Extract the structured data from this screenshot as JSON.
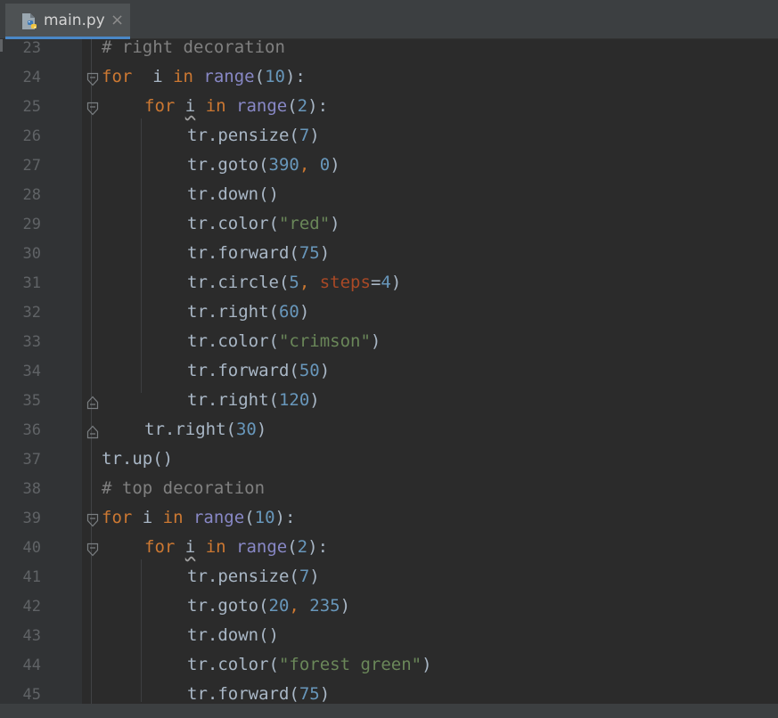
{
  "tab": {
    "filename": "main.py",
    "icon": "python-file-icon",
    "close": "×"
  },
  "colors": {
    "background": "#2b2b2b",
    "gutter": "#313335",
    "keyword": "#cc7832",
    "builtin": "#8888c6",
    "number": "#6897bb",
    "string": "#6a8759",
    "comment": "#808080",
    "kwarg": "#aa4926",
    "text": "#a9b7c6",
    "tab_accent": "#4a88c7"
  },
  "lines": [
    {
      "n": "23",
      "indent": 0,
      "fold": "",
      "tokens": [
        [
          "cm",
          "# right decoration"
        ]
      ]
    },
    {
      "n": "24",
      "indent": 0,
      "fold": "start",
      "tokens": [
        [
          "kw",
          "for"
        ],
        [
          "",
          "  i "
        ],
        [
          "kw",
          "in"
        ],
        [
          "bi",
          " range"
        ],
        [
          "",
          "("
        ],
        [
          "num",
          "10"
        ],
        [
          "",
          "):"
        ]
      ]
    },
    {
      "n": "25",
      "indent": 1,
      "fold": "start",
      "tokens": [
        [
          "kw",
          "for"
        ],
        [
          "",
          " "
        ],
        [
          "sq",
          "i"
        ],
        [
          "",
          " "
        ],
        [
          "kw",
          "in"
        ],
        [
          "bi",
          " range"
        ],
        [
          "",
          "("
        ],
        [
          "num",
          "2"
        ],
        [
          "",
          "):"
        ]
      ]
    },
    {
      "n": "26",
      "indent": 2,
      "fold": "",
      "tokens": [
        [
          "",
          "tr.pensize("
        ],
        [
          "num",
          "7"
        ],
        [
          "",
          ")"
        ]
      ]
    },
    {
      "n": "27",
      "indent": 2,
      "fold": "",
      "tokens": [
        [
          "",
          "tr.goto("
        ],
        [
          "num",
          "390"
        ],
        [
          "kw",
          ", "
        ],
        [
          "num",
          "0"
        ],
        [
          "",
          ")"
        ]
      ]
    },
    {
      "n": "28",
      "indent": 2,
      "fold": "",
      "tokens": [
        [
          "",
          "tr.down()"
        ]
      ]
    },
    {
      "n": "29",
      "indent": 2,
      "fold": "",
      "tokens": [
        [
          "",
          "tr.color("
        ],
        [
          "str",
          "\"red\""
        ],
        [
          "",
          ")"
        ]
      ]
    },
    {
      "n": "30",
      "indent": 2,
      "fold": "",
      "tokens": [
        [
          "",
          "tr.forward("
        ],
        [
          "num",
          "75"
        ],
        [
          "",
          ")"
        ]
      ]
    },
    {
      "n": "31",
      "indent": 2,
      "fold": "",
      "tokens": [
        [
          "",
          "tr.circle("
        ],
        [
          "num",
          "5"
        ],
        [
          "kw",
          ", "
        ],
        [
          "kwarg",
          "steps"
        ],
        [
          "",
          "="
        ],
        [
          "num",
          "4"
        ],
        [
          "",
          ")"
        ]
      ]
    },
    {
      "n": "32",
      "indent": 2,
      "fold": "",
      "tokens": [
        [
          "",
          "tr.right("
        ],
        [
          "num",
          "60"
        ],
        [
          "",
          ")"
        ]
      ]
    },
    {
      "n": "33",
      "indent": 2,
      "fold": "",
      "tokens": [
        [
          "",
          "tr.color("
        ],
        [
          "str",
          "\"crimson\""
        ],
        [
          "",
          ")"
        ]
      ]
    },
    {
      "n": "34",
      "indent": 2,
      "fold": "",
      "tokens": [
        [
          "",
          "tr.forward("
        ],
        [
          "num",
          "50"
        ],
        [
          "",
          ")"
        ]
      ]
    },
    {
      "n": "35",
      "indent": 2,
      "fold": "end",
      "tokens": [
        [
          "",
          "tr.right("
        ],
        [
          "num",
          "120"
        ],
        [
          "",
          ")"
        ]
      ]
    },
    {
      "n": "36",
      "indent": 1,
      "fold": "end",
      "tokens": [
        [
          "",
          "tr.right("
        ],
        [
          "num",
          "30"
        ],
        [
          "",
          ")"
        ]
      ]
    },
    {
      "n": "37",
      "indent": 0,
      "fold": "",
      "tokens": [
        [
          "",
          "tr.up()"
        ]
      ]
    },
    {
      "n": "38",
      "indent": 0,
      "fold": "",
      "tokens": [
        [
          "cm",
          "# top decoration"
        ]
      ]
    },
    {
      "n": "39",
      "indent": 0,
      "fold": "start",
      "tokens": [
        [
          "kw",
          "for"
        ],
        [
          "",
          " i "
        ],
        [
          "kw",
          "in"
        ],
        [
          "bi",
          " range"
        ],
        [
          "",
          "("
        ],
        [
          "num",
          "10"
        ],
        [
          "",
          "):"
        ]
      ]
    },
    {
      "n": "40",
      "indent": 1,
      "fold": "start",
      "tokens": [
        [
          "kw",
          "for"
        ],
        [
          "",
          " "
        ],
        [
          "sq",
          "i"
        ],
        [
          "",
          " "
        ],
        [
          "kw",
          "in"
        ],
        [
          "bi",
          " range"
        ],
        [
          "",
          "("
        ],
        [
          "num",
          "2"
        ],
        [
          "",
          "):"
        ]
      ]
    },
    {
      "n": "41",
      "indent": 2,
      "fold": "",
      "tokens": [
        [
          "",
          "tr.pensize("
        ],
        [
          "num",
          "7"
        ],
        [
          "",
          ")"
        ]
      ]
    },
    {
      "n": "42",
      "indent": 2,
      "fold": "",
      "tokens": [
        [
          "",
          "tr.goto("
        ],
        [
          "num",
          "20"
        ],
        [
          "kw",
          ", "
        ],
        [
          "num",
          "235"
        ],
        [
          "",
          ")"
        ]
      ]
    },
    {
      "n": "43",
      "indent": 2,
      "fold": "",
      "tokens": [
        [
          "",
          "tr.down()"
        ]
      ]
    },
    {
      "n": "44",
      "indent": 2,
      "fold": "",
      "tokens": [
        [
          "",
          "tr.color("
        ],
        [
          "str",
          "\"forest green\""
        ],
        [
          "",
          ")"
        ]
      ]
    },
    {
      "n": "45",
      "indent": 2,
      "fold": "",
      "tokens": [
        [
          "",
          "tr.forward("
        ],
        [
          "num",
          "75"
        ],
        [
          "",
          ")"
        ]
      ]
    }
  ]
}
